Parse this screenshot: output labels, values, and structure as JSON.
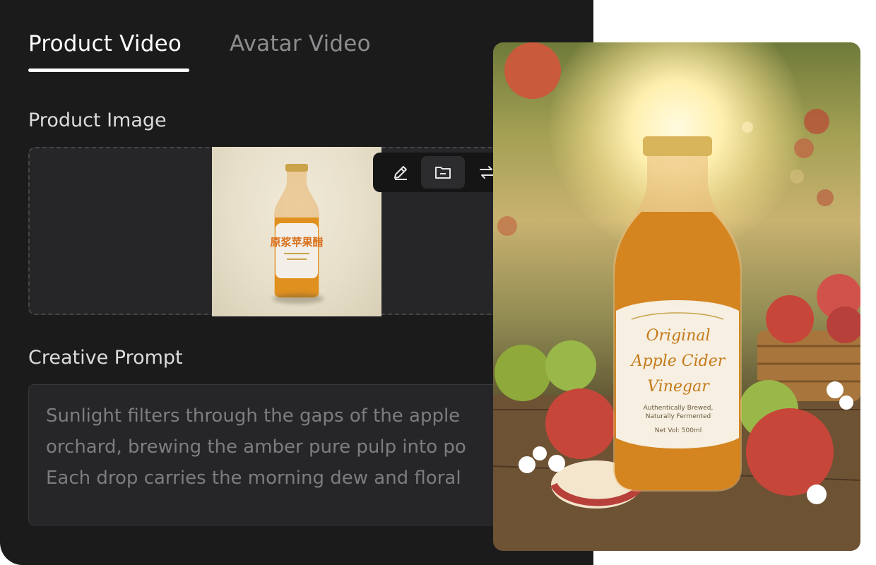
{
  "tabs": {
    "product_video": "Product Video",
    "avatar_video": "Avatar Video"
  },
  "sections": {
    "product_image_label": "Product Image",
    "creative_prompt_label": "Creative Prompt"
  },
  "thumbnail": {
    "label_text_cn": "原浆苹果醋"
  },
  "toolbar": {
    "icons": [
      "edit-pencil-icon",
      "folder-minus-icon",
      "swap-icon"
    ]
  },
  "prompt": {
    "text": "Sunlight filters through the gaps of the apple\norchard, brewing the amber pure pulp into po\nEach drop carries the morning dew and floral"
  },
  "preview": {
    "label_line1": "Original",
    "label_line2": "Apple Cider",
    "label_line3": "Vinegar",
    "label_sub1": "Authentically Brewed,",
    "label_sub2": "Naturally Fermented",
    "label_volume": "Net Vol: 500ml"
  },
  "colors": {
    "panel_bg": "#1b1b1c",
    "active_tab": "#ffffff",
    "inactive_tab": "#8d8d90",
    "amber": "#d7891f"
  }
}
